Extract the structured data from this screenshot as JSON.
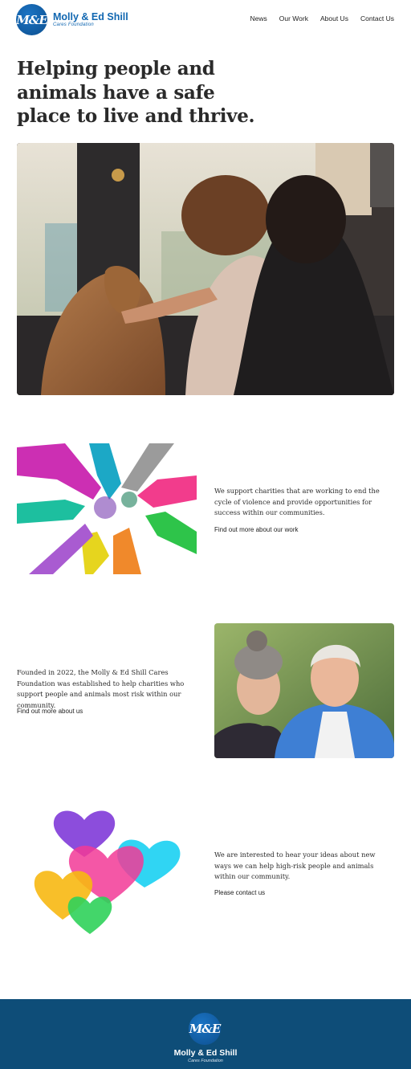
{
  "header": {
    "logo_monogram": "M&E",
    "logo_name": "Molly & Ed Shill",
    "logo_tagline": "Cares Foundation",
    "nav": [
      "News",
      "Our Work",
      "About Us",
      "Contact Us"
    ]
  },
  "hero": {
    "title": "Helping people and animals have a safe place to live and thrive.",
    "image_icon": "photo-family-with-dog"
  },
  "sections": [
    {
      "image_icon": "colorful-hands-illustration",
      "text": "We support charities that are working to end the cycle of violence and provide opportunities for success within our communities.",
      "link": "Find out more about our work"
    },
    {
      "image_icon": "founders-portrait-photo",
      "text": "Founded in 2022, the Molly & Ed Shill Cares Foundation was established to help charities who support people and animals most risk within our community.",
      "link": "Find out more about us"
    },
    {
      "image_icon": "colorful-hearts-illustration",
      "text": "We are interested to hear your ideas about new ways we can help high-risk people and animals within our community.",
      "link": "Please contact us"
    }
  ],
  "footer": {
    "logo_monogram": "M&E",
    "logo_name": "Molly & Ed Shill",
    "logo_tagline": "Cares Foundation"
  },
  "colors": {
    "brand_blue": "#1167b1",
    "footer_bg": "#0e4d78"
  }
}
